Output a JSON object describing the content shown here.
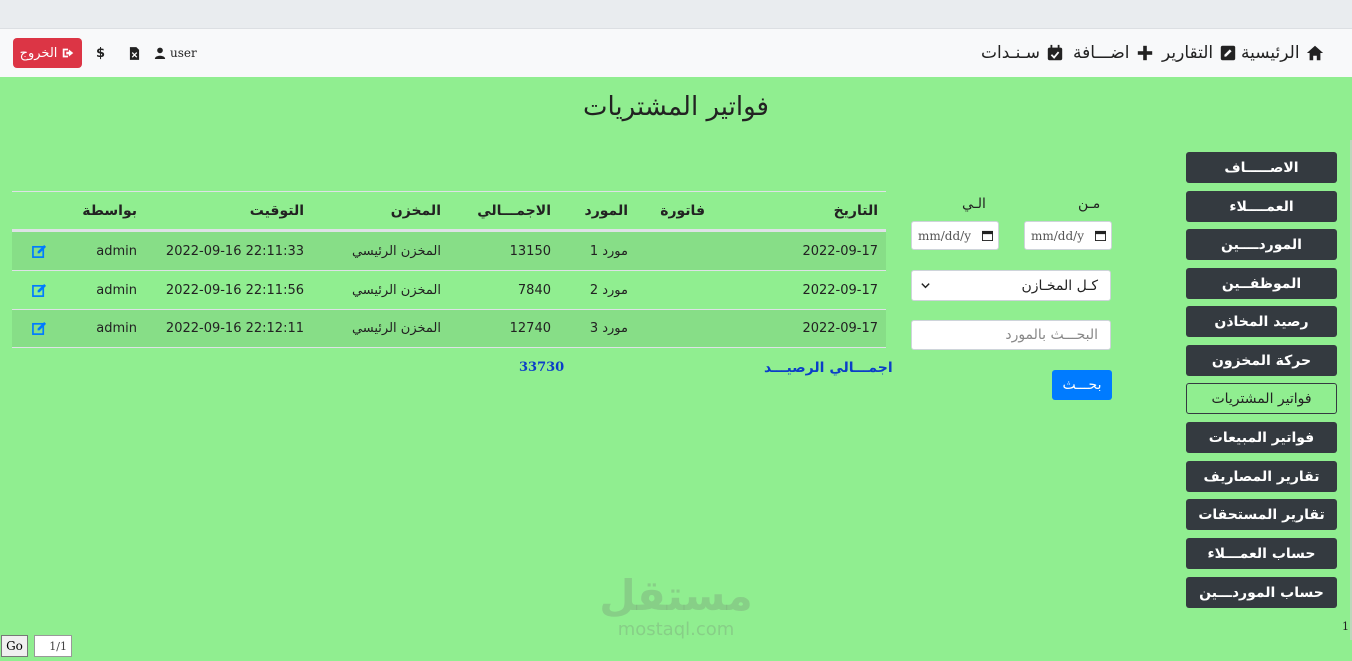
{
  "nav": {
    "home": "الرئيسية",
    "reports": "التقارير",
    "add": "اضـــافة",
    "vouchers": "سـنـدات",
    "logout": "الخروج",
    "currency_symbol": "$",
    "user": "user"
  },
  "page": {
    "title": "فواتير المشتريات"
  },
  "sidebar": {
    "items": [
      {
        "label": "الاصـــــاف"
      },
      {
        "label": "العمــــلاء"
      },
      {
        "label": "الموردــــين"
      },
      {
        "label": "الموظفــين"
      },
      {
        "label": "رصيد المخاذن"
      },
      {
        "label": "حركة المخزون"
      },
      {
        "label": "فواتير المشتريات",
        "active": true
      },
      {
        "label": "فواتير المبيعات"
      },
      {
        "label": "تقارير المصاريف"
      },
      {
        "label": "تقارير المستحقات"
      },
      {
        "label": "حساب العمـــلاء"
      },
      {
        "label": "حساب الموردـــين"
      }
    ]
  },
  "filters": {
    "from_label": "مـن",
    "to_label": "الـي",
    "from_value": "mm/dd/y",
    "to_value": "mm/dd/y",
    "store_select": "كـل المخـازن",
    "search_placeholder": "البحـــث بالمورد",
    "search_button": "بحـــث"
  },
  "table": {
    "headers": {
      "date": "التاريخ",
      "invoice": "فاتورة",
      "supplier": "المورد",
      "total": "الاجمـــالي",
      "store": "المخزن",
      "time": "التوقيت",
      "by": "بواسطة"
    },
    "rows": [
      {
        "date": "2022-09-17",
        "supplier": "مورد 1",
        "total": "13150",
        "store": "المخزن الرئيسي",
        "time": "2022-09-16 22:11:33",
        "by": "admin"
      },
      {
        "date": "2022-09-17",
        "supplier": "مورد 2",
        "total": "7840",
        "store": "المخزن الرئيسي",
        "time": "2022-09-16 22:11:56",
        "by": "admin"
      },
      {
        "date": "2022-09-17",
        "supplier": "مورد 3",
        "total": "12740",
        "store": "المخزن الرئيسي",
        "time": "2022-09-16 22:12:11",
        "by": "admin"
      }
    ],
    "total_label": "اجمـــالي الرصيـــد",
    "total_value": "33730"
  },
  "pagination": {
    "go": "Go",
    "page_value": "1/1",
    "page_number": "1"
  },
  "watermark": {
    "ar": "مستقل",
    "en": "mostaql.com"
  },
  "colors": {
    "background": "#90ee90",
    "sidebar": "#343a40",
    "danger": "#dc3545",
    "primary": "#007bff",
    "total_text": "#0b3ec8"
  }
}
